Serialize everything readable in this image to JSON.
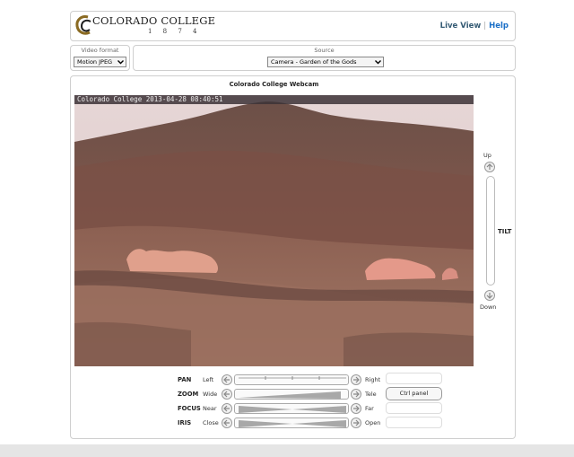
{
  "header": {
    "brand": "COLORADO COLLEGE",
    "year": "1 8 7 4",
    "nav": {
      "live_view": "Live View",
      "separator": "|",
      "help": "Help"
    }
  },
  "video_format": {
    "label": "Video format",
    "value": "Motion JPEG"
  },
  "source": {
    "label": "Source",
    "value": "Camera - Garden of the Gods"
  },
  "camera": {
    "title": "Colorado College Webcam",
    "overlay": "Colorado College 2013-04-28 08:40:51"
  },
  "tilt": {
    "up": "Up",
    "label": "TILT",
    "down": "Down"
  },
  "controls": [
    {
      "name": "PAN",
      "left": "Left",
      "right": "Right"
    },
    {
      "name": "ZOOM",
      "left": "Wide",
      "right": "Tele"
    },
    {
      "name": "FOCUS",
      "left": "Near",
      "right": "Far"
    },
    {
      "name": "IRIS",
      "left": "Close",
      "right": "Open"
    }
  ],
  "ctrl_panel_label": "Ctrl panel",
  "icons": {
    "arrow": "arrow-icon",
    "logo": "colorado-college-logo"
  }
}
